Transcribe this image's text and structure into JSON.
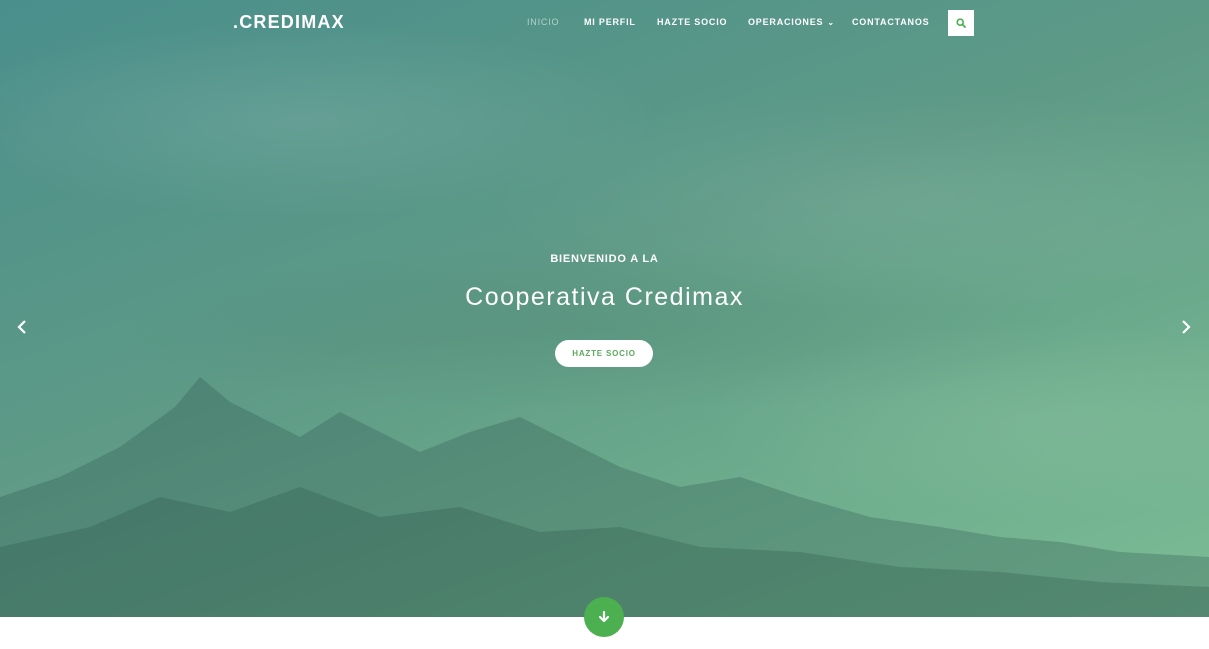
{
  "brand": ".CREDIMAX",
  "nav": {
    "items": [
      {
        "label": "INICIO"
      },
      {
        "label": "MI PERFIL"
      },
      {
        "label": "HAZTE SOCIO"
      },
      {
        "label": "OPERACIONES"
      },
      {
        "label": "CONTACTANOS"
      }
    ],
    "search_icon": "search-icon"
  },
  "hero": {
    "subtitle": "BIENVENIDO A LA",
    "title": "Cooperativa Credimax",
    "cta_label": "HAZTE SOCIO",
    "prev_icon": "chevron-left-icon",
    "next_icon": "chevron-right-icon",
    "scroll_icon": "arrow-down-icon"
  },
  "colors": {
    "accent": "#4caf50",
    "cta_text": "#5aaa5e"
  }
}
